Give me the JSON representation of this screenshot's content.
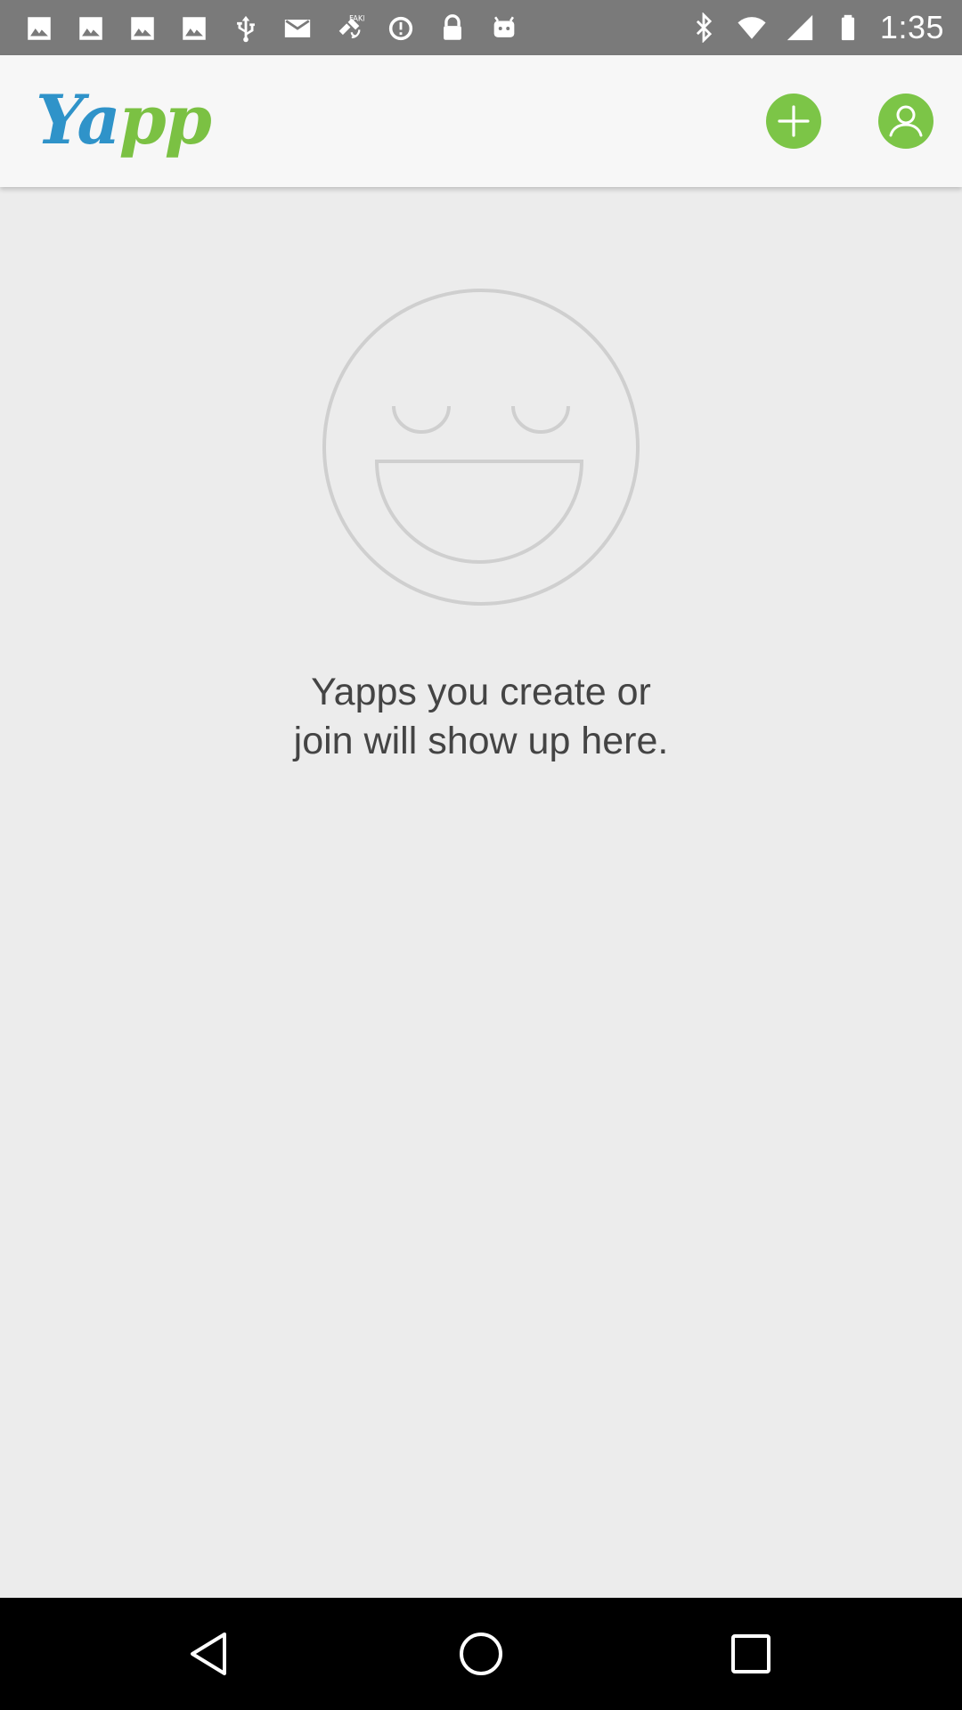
{
  "status_bar": {
    "time": "1:35",
    "left_icons": [
      "photo-icon",
      "photo-icon",
      "photo-icon",
      "photo-icon",
      "usb-icon",
      "mail-icon",
      "satellite-fake-icon",
      "data-saver-icon",
      "lock-icon",
      "android-icon"
    ],
    "right_icons": [
      "bluetooth-icon",
      "wifi-icon",
      "signal-icon",
      "battery-icon"
    ],
    "fake_label": "FAKE"
  },
  "app_bar": {
    "logo_part1": "Ya",
    "logo_part2": "pp",
    "add_icon": "plus-icon",
    "profile_icon": "user-icon"
  },
  "empty_state": {
    "illustration": "smiley-face-icon",
    "message": "Yapps you create or\njoin will show up here."
  },
  "nav_bar": {
    "buttons": [
      "back-icon",
      "home-icon",
      "recents-icon"
    ]
  },
  "colors": {
    "status_bar": "#7a7a7a",
    "app_bar": "#f7f7f7",
    "background": "#ececec",
    "accent_green": "#7cc547",
    "logo_blue": "#2f93c9",
    "illustration_stroke": "#cfcfcf",
    "text": "#444444"
  }
}
